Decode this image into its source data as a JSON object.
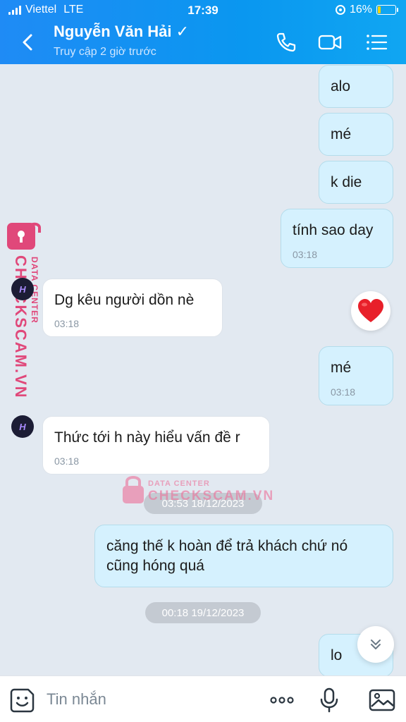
{
  "status_bar": {
    "carrier": "Viettel",
    "network": "LTE",
    "time": "17:39",
    "battery": "16%"
  },
  "header": {
    "contact_name": "Nguyễn Văn Hải",
    "verified_mark": "✓",
    "last_seen": "Truy cập 2 giờ trước"
  },
  "avatar_text": "H",
  "messages": [
    {
      "from": "me",
      "text": "alo"
    },
    {
      "from": "me",
      "text": "mé"
    },
    {
      "from": "me",
      "text": "k die"
    },
    {
      "from": "me",
      "text": "tính sao day",
      "time": "03:18"
    },
    {
      "from": "them",
      "text": "Dg kêu người dồn nè",
      "time": "03:18"
    },
    {
      "from": "me",
      "text": "mé",
      "time": "03:18"
    },
    {
      "from": "them",
      "text": "Thức tới h này hiểu vấn đề r",
      "time": "03:18"
    },
    {
      "from": "me",
      "text": "căng thế k hoàn để trả khách chứ nó\ncũng hóng quá"
    },
    {
      "from": "me",
      "text": "lo"
    }
  ],
  "date_separators": [
    "03:53 18/12/2023",
    "00:18 19/12/2023"
  ],
  "watermark": {
    "line1": "DATA CENTER",
    "line2": "CHECKSCAM.VN"
  },
  "input": {
    "placeholder": "Tin nhắn"
  },
  "colors": {
    "header": "#0a97f0",
    "my_bubble": "#d5f1fe",
    "their_bubble": "#ffffff",
    "watermark": "#e0487a"
  }
}
